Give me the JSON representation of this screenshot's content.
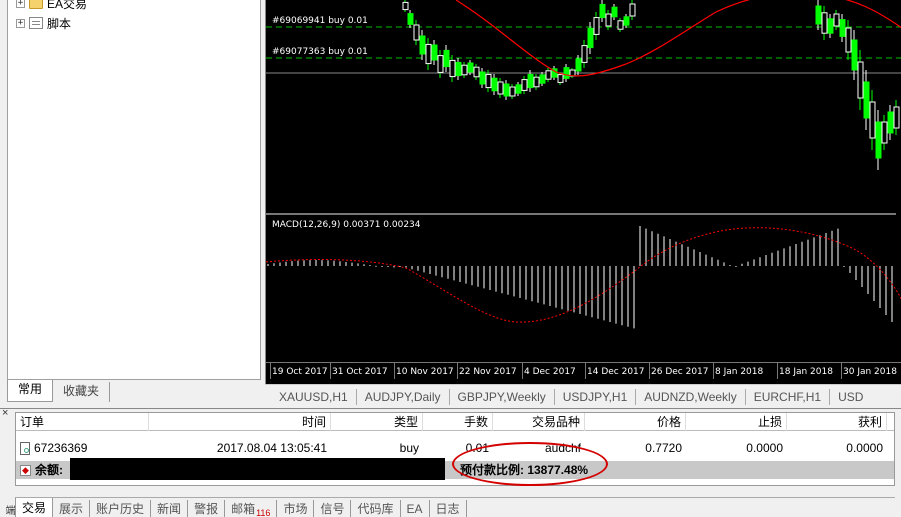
{
  "navigator": {
    "tree": [
      {
        "label": "EA交易",
        "icon": "folder-icon"
      },
      {
        "label": "脚本",
        "icon": "script-icon"
      }
    ],
    "tabs": [
      {
        "label": "常用",
        "active": true
      },
      {
        "label": "收藏夹",
        "active": false
      }
    ]
  },
  "chart": {
    "orders": [
      {
        "label": "#69069941 buy 0.01"
      },
      {
        "label": "#69077363 buy 0.01"
      }
    ],
    "indicator_label": "MACD(12,26,9) 0.00371 0.00234",
    "x_ticks": [
      "19 Oct 2017",
      "31 Oct 2017",
      "10 Nov 2017",
      "22 Nov 2017",
      "4 Dec 2017",
      "14 Dec 2017",
      "26 Dec 2017",
      "8 Jan 2018",
      "18 Jan 2018",
      "30 Jan 2018"
    ],
    "colors": {
      "bull": "#00ff00",
      "bear": "#ffffff",
      "ma": "#ff0000",
      "signal": "#ff0000",
      "order_line": "#00c000"
    }
  },
  "chart_tabs": [
    "XAUUSD,H1",
    "AUDJPY,Daily",
    "GBPJPY,Weekly",
    "USDJPY,H1",
    "AUDNZD,Weekly",
    "EURCHF,H1",
    "USD"
  ],
  "terminal": {
    "side_title": "终端",
    "columns": [
      "订单",
      "时间",
      "类型",
      "手数",
      "交易品种",
      "价格",
      "止损",
      "获利"
    ],
    "order": {
      "id": "67236369",
      "time": "2017.08.04 13:05:41",
      "type": "buy",
      "lots": "0.01",
      "symbol": "audchf",
      "price": "0.7720",
      "sl": "0.0000",
      "tp": "0.0000"
    },
    "balance_label": "余额:",
    "margin_level": "预付款比例: 13877.48%",
    "tabs": [
      {
        "label": "交易",
        "active": true
      },
      {
        "label": "展示"
      },
      {
        "label": "账户历史"
      },
      {
        "label": "新闻"
      },
      {
        "label": "警报"
      },
      {
        "label": "邮箱",
        "badge": "116"
      },
      {
        "label": "市场"
      },
      {
        "label": "信号"
      },
      {
        "label": "代码库"
      },
      {
        "label": "EA"
      },
      {
        "label": "日志"
      }
    ],
    "highlight_color": "#d40000"
  }
}
